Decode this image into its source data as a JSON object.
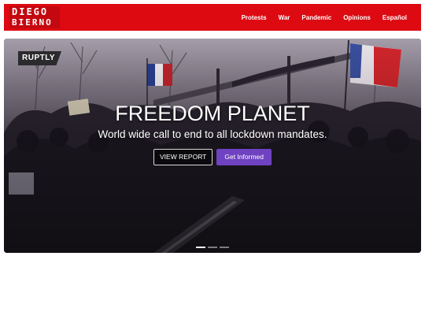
{
  "brand": {
    "line1": "DIEGO",
    "line2": "BIERNO"
  },
  "nav": {
    "items": [
      {
        "label": "Protests"
      },
      {
        "label": "War"
      },
      {
        "label": "Pandemic"
      },
      {
        "label": "Opinions"
      },
      {
        "label": "Español"
      }
    ]
  },
  "hero": {
    "watermark": "RUPTLY",
    "title": "FREEDOM PLANET",
    "subtitle": "World wide call to end to all lockdown mandates.",
    "buttons": {
      "view_report": "VIEW REPORT",
      "get_informed": "Get Informed"
    },
    "slide_count": 3,
    "active_slide": 1
  },
  "colors": {
    "navbar": "#dd0a12",
    "primary_button": "#6f42c1"
  }
}
